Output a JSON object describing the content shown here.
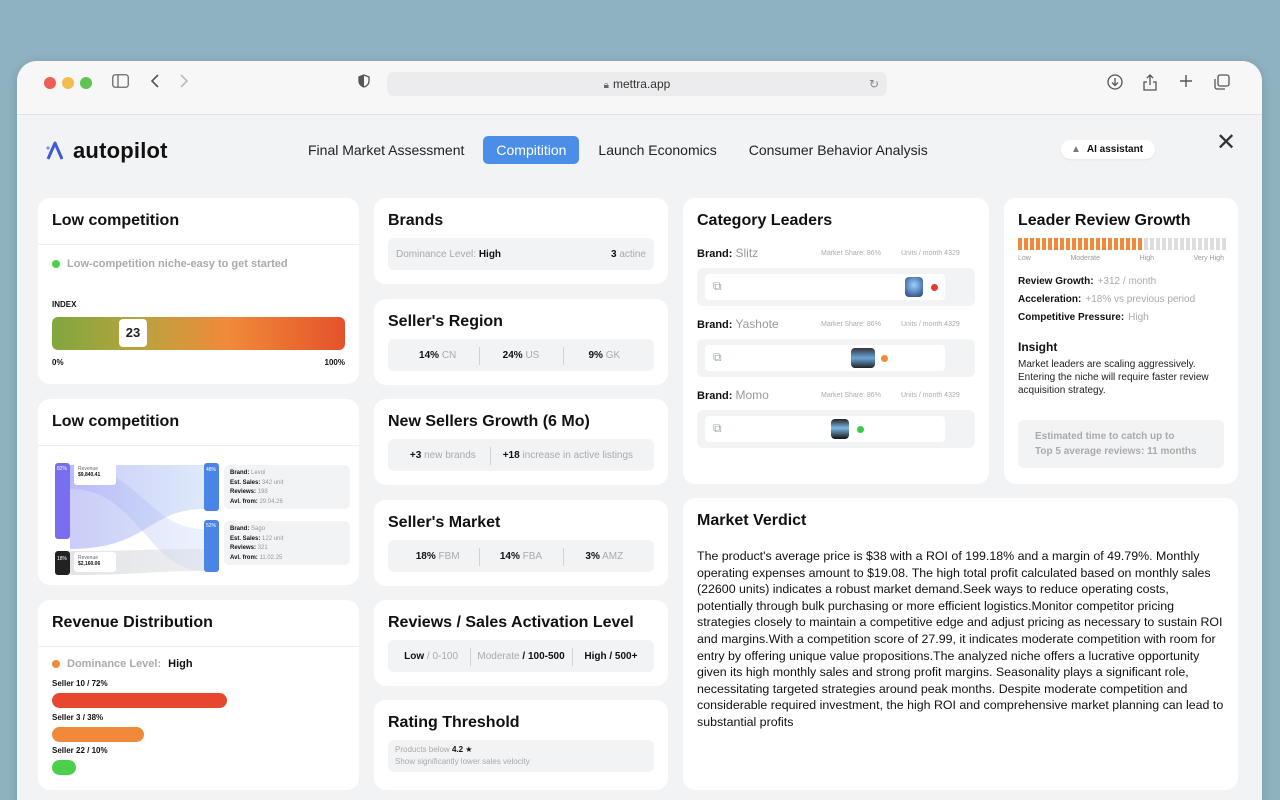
{
  "browser": {
    "url": "mettra.app"
  },
  "app": {
    "logo_text": "autopilot",
    "tabs": [
      {
        "label": "Final Market Assessment"
      },
      {
        "label": "Compitition"
      },
      {
        "label": "Launch Economics"
      },
      {
        "label": "Consumer Behavior Analysis"
      }
    ],
    "ai_assistant": "AI assistant"
  },
  "low_competition_index": {
    "title": "Low competition",
    "status": "Low-competition niche-easy to get started",
    "index_label": "INDEX",
    "index_value": "23",
    "index_fraction": 0.23,
    "min_label": "0%",
    "max_label": "100%"
  },
  "low_competition_flow": {
    "title": "Low competition",
    "top_left_pct": "82%",
    "top_left_label": "Revenue",
    "top_left_value": "$9,840.41",
    "bottom_left_pct": "18%",
    "bottom_left_label": "Revenue",
    "bottom_left_value": "$2,160.06",
    "right_top_pct": "48%",
    "right_bottom_pct": "52%",
    "brand1": {
      "brand_key": "Brand:",
      "brand_val": "Levoi",
      "sales_key": "Est. Sales:",
      "sales_val": "342 unit",
      "reviews_key": "Reviews:",
      "reviews_val": "198",
      "from_key": "Avl. from:",
      "from_val": "29.04.26"
    },
    "brand2": {
      "brand_key": "Brand:",
      "brand_val": "Sago",
      "sales_key": "Est. Sales:",
      "sales_val": "122 unit",
      "reviews_key": "Reviews:",
      "reviews_val": "321",
      "from_key": "Avl. from:",
      "from_val": "11.02.25"
    }
  },
  "revenue_distribution": {
    "title": "Revenue Distribution",
    "dominance_key": "Dominance Level:",
    "dominance_val": "High",
    "sellers": [
      {
        "label": "Seller 10 / 72%",
        "share": 0.72,
        "color": "#e8472f"
      },
      {
        "label": "Seller 3 / 38%",
        "share": 0.38,
        "color": "#f08a3a"
      },
      {
        "label": "Seller 22 / 10%",
        "share": 0.1,
        "color": "#4cd04b"
      }
    ]
  },
  "brands": {
    "title": "Brands",
    "dominance_key": "Dominance Level:",
    "dominance_val": "High",
    "count": "3",
    "count_suffix": "actine"
  },
  "sellers_region": {
    "title": "Seller's Region",
    "items": [
      {
        "value": "14%",
        "label": "CN"
      },
      {
        "value": "24%",
        "label": "US"
      },
      {
        "value": "9%",
        "label": "GK"
      }
    ]
  },
  "new_sellers": {
    "title": "New Sellers Growth (6 Mo)",
    "items": [
      {
        "value": "+3",
        "label": "new brands"
      },
      {
        "value": "+18",
        "label": "increase in active listings"
      }
    ]
  },
  "sellers_market": {
    "title": "Seller's Market",
    "items": [
      {
        "value": "18%",
        "label": "FBM"
      },
      {
        "value": "14%",
        "label": "FBA"
      },
      {
        "value": "3%",
        "label": "AMZ"
      }
    ]
  },
  "reviews_activation": {
    "title": "Reviews / Sales Activation Level",
    "items": [
      {
        "label": "Low",
        "range": "/ 0-100"
      },
      {
        "label": "Moderate",
        "range": "/ 100-500"
      },
      {
        "label": "High",
        "range": "/ 500+"
      }
    ]
  },
  "rating_threshold": {
    "title": "Rating Threshold",
    "line1_prefix": "Products below",
    "line1_value": "4.2",
    "star": "★",
    "line2": "Show significantly lower sales velocity"
  },
  "category_leaders": {
    "title": "Category Leaders",
    "brand_key": "Brand:",
    "leaders": [
      {
        "brand": "Slitz",
        "share": "Market Share: 86%",
        "units": "Units / month 4329",
        "dot": "#e53a2f"
      },
      {
        "brand": "Yashote",
        "share": "Market Share: 86%",
        "units": "Units / month 4329",
        "dot": "#f08a3a"
      },
      {
        "brand": "Momo",
        "share": "Market Share: 86%",
        "units": "Units / month 4329",
        "dot": "#3bc94a"
      }
    ]
  },
  "leader_review_growth": {
    "title": "Leader Review Growth",
    "level_fraction": 0.6,
    "scale": [
      "Low",
      "Moderate",
      "High",
      "Very High"
    ],
    "growth_key": "Review Growth:",
    "growth_val": "+312 / month",
    "accel_key": "Acceleration:",
    "accel_val": "+18% vs previous period",
    "pressure_key": "Competitive Pressure:",
    "pressure_val": "High",
    "insight_title": "Insight",
    "insight_text": "Market leaders are scaling aggressively. Entering the niche will require faster review acquisition strategy.",
    "estimate_line1": "Estimated time to catch up to",
    "estimate_line2": "Top 5 average reviews: 11 months"
  },
  "market_verdict": {
    "title": "Market Verdict",
    "text": "The product's average price is $38 with a ROI of 199.18% and a margin of 49.79%. Monthly operating expenses amount to $19.08. The high total profit calculated based on monthly sales (22600 units) indicates a robust market demand.Seek ways to reduce operating costs, potentially through bulk purchasing or more efficient logistics.Monitor competitor pricing strategies closely to maintain a competitive edge and adjust pricing as necessary to sustain ROI and margins.With a competition score of 27.99, it indicates moderate competition with room for entry by offering unique value propositions.The analyzed niche offers a lucrative opportunity given its high monthly sales and strong profit margins. Seasonality plays a significant role, necessitating targeted strategies around peak months. Despite moderate competition and considerable required investment, the high ROI and comprehensive market planning can lead to substantial profits"
  },
  "colors": {
    "accent": "#4b8ee8",
    "status_green": "#4cd04b",
    "dominance_orange": "#f08a3a"
  }
}
